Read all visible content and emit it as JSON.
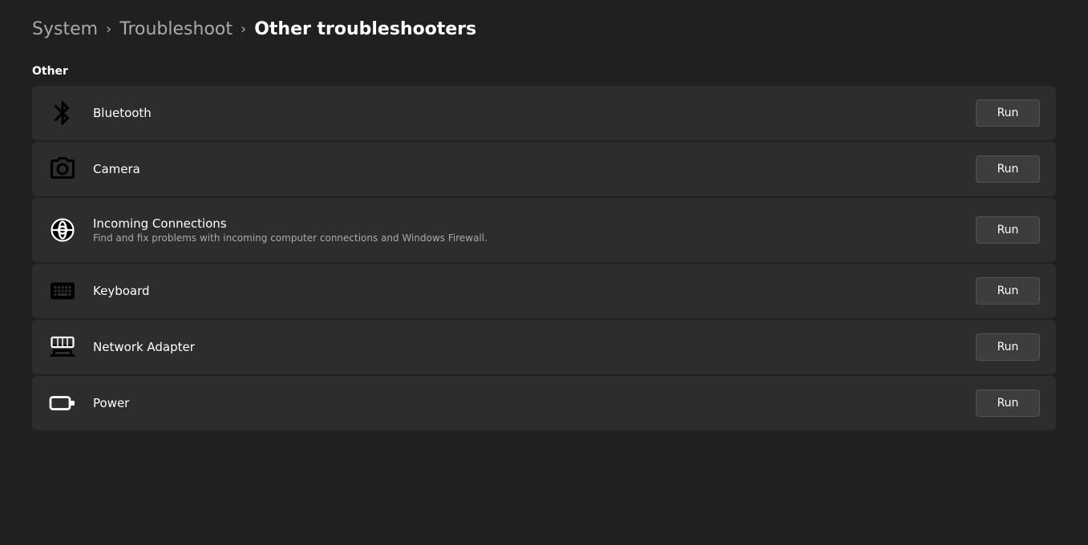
{
  "breadcrumb": {
    "items": [
      {
        "label": "System",
        "link": true
      },
      {
        "label": "Troubleshoot",
        "link": true
      },
      {
        "label": "Other troubleshooters",
        "link": false
      }
    ],
    "separator": "›"
  },
  "section": {
    "label": "Other"
  },
  "troubleshooters": [
    {
      "id": "bluetooth",
      "icon": "bluetooth",
      "title": "Bluetooth",
      "description": "",
      "run_label": "Run"
    },
    {
      "id": "camera",
      "icon": "camera",
      "title": "Camera",
      "description": "",
      "run_label": "Run"
    },
    {
      "id": "incoming-connections",
      "icon": "connections",
      "title": "Incoming Connections",
      "description": "Find and fix problems with incoming computer connections and Windows Firewall.",
      "run_label": "Run"
    },
    {
      "id": "keyboard",
      "icon": "keyboard",
      "title": "Keyboard",
      "description": "",
      "run_label": "Run"
    },
    {
      "id": "network-adapter",
      "icon": "network",
      "title": "Network Adapter",
      "description": "",
      "run_label": "Run"
    },
    {
      "id": "power",
      "icon": "power",
      "title": "Power",
      "description": "",
      "run_label": "Run"
    }
  ]
}
